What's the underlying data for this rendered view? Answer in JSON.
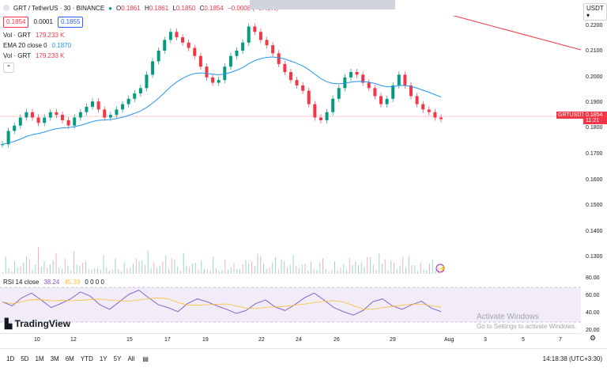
{
  "symbol": {
    "name": "GRT / TetherUS · 30 · BINANCE"
  },
  "ohlc": {
    "o_label": "O",
    "o": "0.1861",
    "h_label": "H",
    "h": "0.1861",
    "l_label": "L",
    "l": "0.1850",
    "c_label": "C",
    "c": "0.1854",
    "chg": "−0.0008 (−0.43%)"
  },
  "quote": {
    "bid": "0.1854",
    "spread": "0.0001",
    "ask": "0.1855"
  },
  "indicators": [
    {
      "label": "Vol · GRT",
      "value": "179.233 K"
    },
    {
      "label": "EMA 20 close 0",
      "value": "0.1870"
    },
    {
      "label": "Vol · GRT",
      "value": "179.233 K"
    }
  ],
  "collapse_icon": "chevron-up-icon",
  "currency": "USDT",
  "price_axis": [
    "0.2200",
    "0.2100",
    "0.2000",
    "0.1900",
    "0.1800",
    "0.1700",
    "0.1600",
    "0.1500",
    "0.1400",
    "0.1300"
  ],
  "last_price": {
    "symbol": "GRTUSDT",
    "price": "0.1854",
    "countdown": "11:21"
  },
  "rsi": {
    "label": "RSI 14 close",
    "v1": "38.24",
    "v2": "45.39",
    "v3": "0 0 0 0",
    "axis": [
      "80.00",
      "60.00",
      "40.00",
      "20.00"
    ]
  },
  "time_axis": [
    "10",
    "12",
    "15",
    "17",
    "19",
    "22",
    "24",
    "26",
    "29",
    "Aug",
    "3",
    "5",
    "7"
  ],
  "bottom_bar": {
    "ranges": [
      "1D",
      "5D",
      "1M",
      "3M",
      "6M",
      "YTD",
      "1Y",
      "5Y",
      "All"
    ],
    "time": "14:18:38 (UTC+3:30)"
  },
  "brand": "TradingView",
  "watermark": {
    "title": "Activate Windows",
    "sub": "Go to Settings to activate Windows."
  },
  "colors": {
    "up": "#089981",
    "down": "#f23645",
    "ema": "#2196f3",
    "rsi": "#7e57c2",
    "rsi_ma": "#fbc02d",
    "accent": "#2962ff"
  },
  "chart_data": {
    "type": "candlestick",
    "ylim": [
      0.127,
      0.224
    ],
    "ema_last": 0.187,
    "last": 0.1854,
    "closes": [
      0.176,
      0.181,
      0.183,
      0.186,
      0.188,
      0.186,
      0.184,
      0.186,
      0.188,
      0.187,
      0.185,
      0.183,
      0.186,
      0.188,
      0.19,
      0.192,
      0.189,
      0.186,
      0.187,
      0.189,
      0.191,
      0.193,
      0.195,
      0.197,
      0.202,
      0.207,
      0.211,
      0.215,
      0.218,
      0.216,
      0.214,
      0.212,
      0.209,
      0.205,
      0.201,
      0.199,
      0.2,
      0.205,
      0.209,
      0.211,
      0.214,
      0.22,
      0.218,
      0.215,
      0.213,
      0.21,
      0.206,
      0.203,
      0.2,
      0.198,
      0.196,
      0.191,
      0.186,
      0.185,
      0.188,
      0.193,
      0.197,
      0.201,
      0.203,
      0.202,
      0.199,
      0.197,
      0.194,
      0.191,
      0.193,
      0.198,
      0.202,
      0.198,
      0.194,
      0.191,
      0.189,
      0.188,
      0.186,
      0.1854
    ],
    "volume_spikes": [
      0.1,
      0.45,
      0.2,
      0.15,
      0.3,
      0.2,
      0.35,
      0.25,
      0.5,
      0.6,
      0.3,
      0.25,
      0.95,
      0.4,
      0.3,
      0.2,
      0.45,
      0.3,
      0.6,
      0.25,
      0.35,
      0.4,
      0.3,
      0.2,
      0.55,
      0.3,
      0.4,
      0.25,
      0.35,
      0.2,
      0.3,
      0.15,
      0.2,
      0.25,
      0.45,
      0.2,
      0.15
    ],
    "rsi_values": [
      55,
      48,
      62,
      70,
      58,
      45,
      52,
      60,
      72,
      65,
      50,
      42,
      55,
      68,
      75,
      62,
      50,
      45,
      38,
      52,
      60,
      55,
      48,
      42,
      35,
      40,
      52,
      58,
      46,
      40,
      50,
      62,
      70,
      58,
      45,
      38,
      32,
      40,
      55,
      60,
      48,
      42,
      50,
      56,
      44,
      38
    ]
  }
}
